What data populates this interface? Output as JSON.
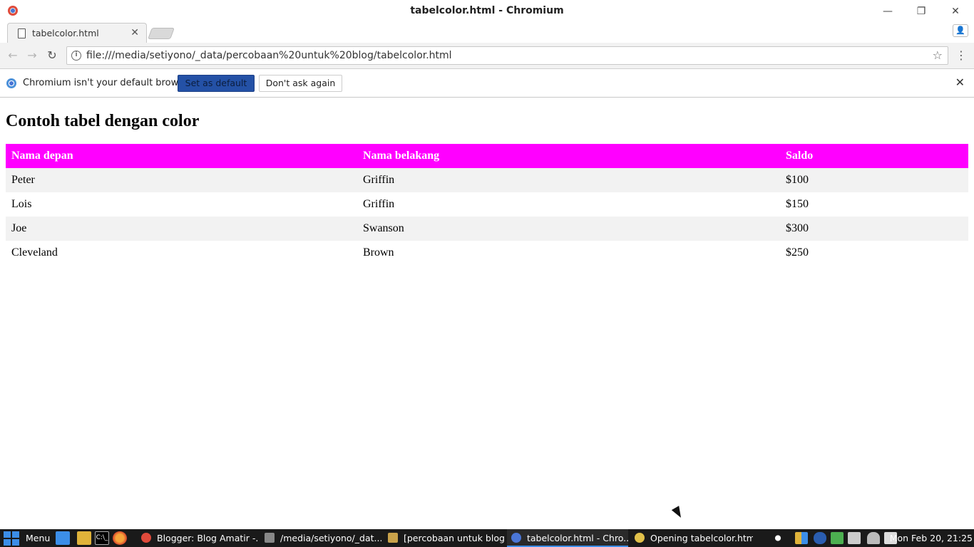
{
  "window": {
    "title": "tabelcolor.html - Chromium",
    "minimize": "—",
    "restore": "❐",
    "close": "✕"
  },
  "tabs": [
    {
      "label": "tabelcolor.html",
      "close": "✕"
    }
  ],
  "toolbar": {
    "back": "←",
    "forward": "→",
    "reload": "↻",
    "url": "file:///media/setiyono/_data/percobaan%20untuk%20blog/tabelcolor.html",
    "star": "☆",
    "menu": "⋮"
  },
  "infobar": {
    "message": "Chromium isn't your default browser.",
    "set_default_label": "Set as default",
    "dont_ask_label": "Don't ask again",
    "close": "✕"
  },
  "page": {
    "heading": "Contoh tabel dengan color",
    "table": {
      "headers": [
        "Nama depan",
        "Nama belakang",
        "Saldo"
      ],
      "rows": [
        [
          "Peter",
          "Griffin",
          "$100"
        ],
        [
          "Lois",
          "Griffin",
          "$150"
        ],
        [
          "Joe",
          "Swanson",
          "$300"
        ],
        [
          "Cleveland",
          "Brown",
          "$250"
        ]
      ],
      "header_color": "#ff00ff",
      "stripe_color": "#f2f2f2"
    }
  },
  "taskbar": {
    "start_label": "Menu",
    "tasks": [
      {
        "label": "Blogger: Blog Amatir -...",
        "icon": "chromium-icon",
        "color": "#e04a3b"
      },
      {
        "label": "/media/setiyono/_dat...",
        "icon": "terminal-icon",
        "color": "#888888"
      },
      {
        "label": "[percobaan untuk blog]",
        "icon": "folder-icon",
        "color": "#c9a24a"
      },
      {
        "label": "tabelcolor.html - Chro...",
        "icon": "chromium-icon",
        "color": "#4a76d6"
      },
      {
        "label": "Opening tabelcolor.html",
        "icon": "globe-icon",
        "color": "#e0c04a"
      }
    ],
    "clock": "Mon Feb 20, 21:25"
  }
}
